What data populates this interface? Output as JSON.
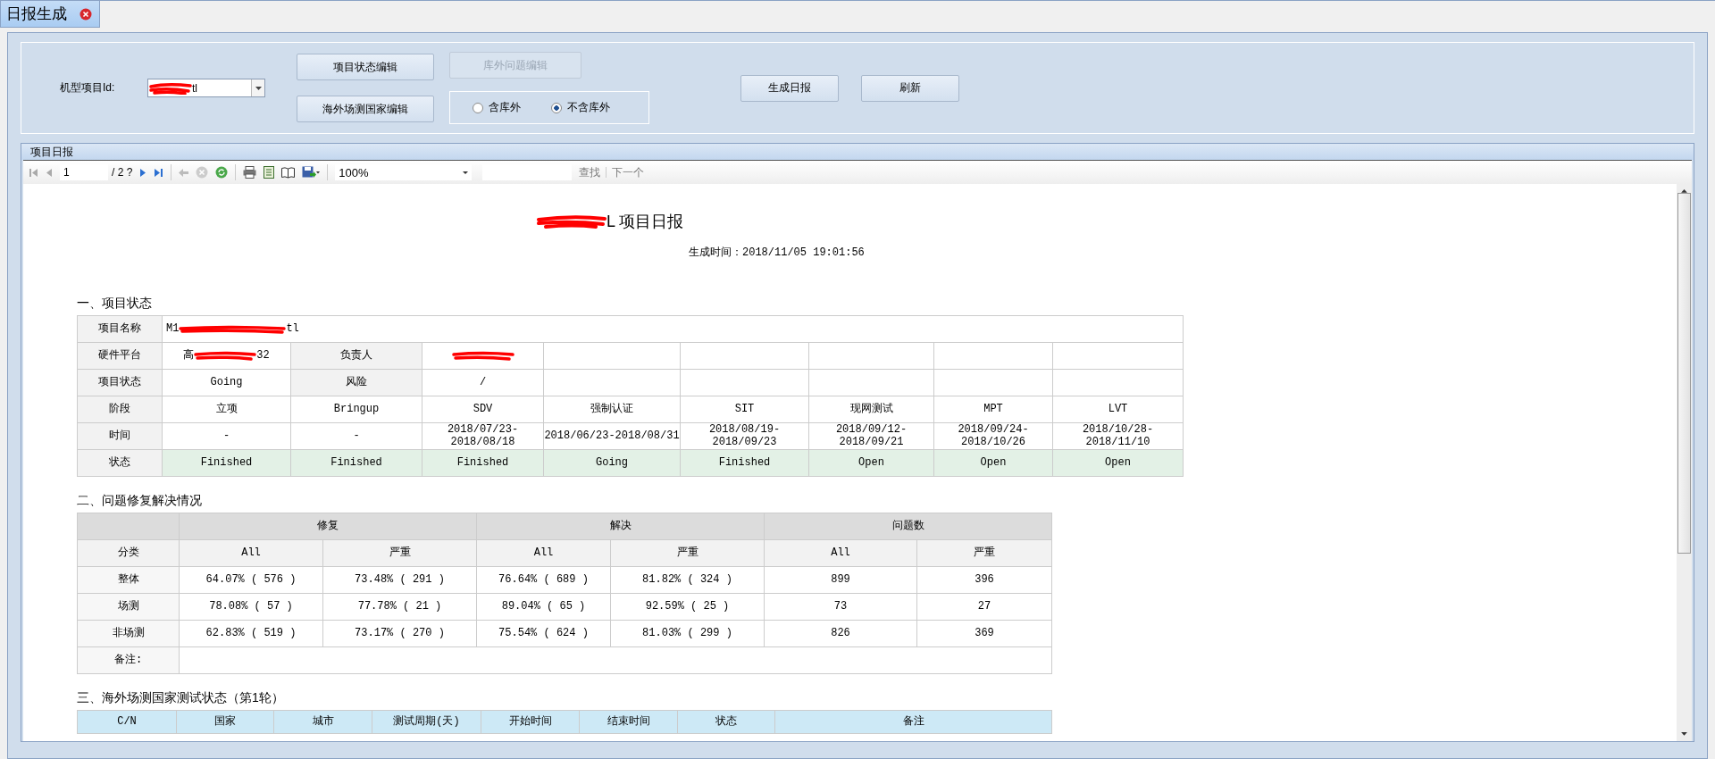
{
  "tab": {
    "label": "日报生成",
    "selected": true
  },
  "form": {
    "model_id_label": "机型项目Id:",
    "model_id_value": "tl",
    "model_id_redacted": true,
    "buttons": [
      {
        "label": "项目状态编辑",
        "disabled": false,
        "kind": "edit"
      },
      {
        "label": "海外场测国家编辑",
        "disabled": false,
        "kind": "edit"
      },
      {
        "label": "库外问题编辑",
        "disabled": true,
        "kind": "edit"
      },
      {
        "label": "生成日报",
        "disabled": false,
        "kind": "action"
      },
      {
        "label": "刷新",
        "disabled": false,
        "kind": "action"
      }
    ],
    "radios": [
      {
        "label": "含库外",
        "selected": false
      },
      {
        "label": "不含库外",
        "selected": true
      }
    ]
  },
  "report_panel": {
    "title": "项目日报"
  },
  "toolbar": {
    "page": "1",
    "page_total": "/ 2 ?",
    "zoom": "100%",
    "find": "查找",
    "next": "下一个"
  },
  "report": {
    "title": "L 项目日报",
    "title_redacted": true,
    "generated": "生成时间：2018/11/05 19:01:56",
    "section1": {
      "heading": "一、项目状态",
      "name_row": {
        "label": "项目名称",
        "before": "M1",
        "after": "tl",
        "redacted": true
      },
      "rows": [
        {
          "highlighted": false,
          "cells": [
            {
              "text": "硬件平台",
              "kind": "label"
            },
            {
              "before": "高",
              "text": "32",
              "redacted": true
            },
            {
              "text": "负责人",
              "kind": "label"
            },
            {
              "redacted": true
            },
            null,
            null,
            null,
            null,
            null
          ]
        },
        {
          "highlighted": false,
          "cells": [
            {
              "text": "项目状态",
              "kind": "label"
            },
            {
              "text": "Going"
            },
            {
              "text": "风险",
              "kind": "label"
            },
            {
              "text": "/"
            },
            null,
            null,
            null,
            null,
            null
          ]
        },
        {
          "highlighted": false,
          "cells": [
            {
              "text": "阶段",
              "kind": "label"
            },
            {
              "text": "立项"
            },
            {
              "text": "Bringup"
            },
            {
              "text": "SDV"
            },
            {
              "text": "强制认证"
            },
            {
              "text": "SIT"
            },
            {
              "text": "现网测试"
            },
            {
              "text": "MPT"
            },
            {
              "text": "LVT"
            }
          ]
        },
        {
          "highlighted": false,
          "cells": [
            {
              "text": "时间",
              "kind": "label"
            },
            {
              "text": "-"
            },
            {
              "text": "-"
            },
            {
              "text": "2018/07/23-\n2018/08/18"
            },
            {
              "text": "2018/06/23-2018/08/31"
            },
            {
              "text": "2018/08/19-\n2018/09/23"
            },
            {
              "text": "2018/09/12-\n2018/09/21"
            },
            {
              "text": "2018/09/24-\n2018/10/26"
            },
            {
              "text": "2018/10/28-\n2018/11/10"
            }
          ]
        },
        {
          "highlighted": true,
          "cells": [
            {
              "text": "状态",
              "kind": "label"
            },
            {
              "text": "Finished"
            },
            {
              "text": "Finished"
            },
            {
              "text": "Finished"
            },
            {
              "text": "Going"
            },
            {
              "text": "Finished"
            },
            {
              "text": "Open"
            },
            {
              "text": "Open"
            },
            {
              "text": "Open"
            }
          ]
        }
      ]
    },
    "section2": {
      "heading": "二、问题修复解决情况",
      "groups": [
        "修复",
        "解决",
        "问题数"
      ],
      "columns": [
        "分类",
        "All",
        "严重",
        "All",
        "严重",
        "All",
        "严重"
      ],
      "rows": [
        [
          "整体",
          "64.07% ( 576 )",
          "73.48% ( 291 )",
          "76.64% ( 689 )",
          "81.82% ( 324 )",
          "899",
          "396"
        ],
        [
          "场测",
          "78.08% ( 57 )",
          "77.78% ( 21 )",
          "89.04% ( 65 )",
          "92.59% ( 25 )",
          "73",
          "27"
        ],
        [
          "非场测",
          "62.83% ( 519 )",
          "73.17% ( 270 )",
          "75.54% ( 624 )",
          "81.03% ( 299 )",
          "826",
          "369"
        ]
      ],
      "note_label": "备注:"
    },
    "section3": {
      "heading": "三、海外场测国家测试状态（第1轮）",
      "columns": [
        "C/N",
        "国家",
        "城市",
        "测试周期(天)",
        "开始时间",
        "结束时间",
        "状态",
        "备注"
      ]
    }
  }
}
